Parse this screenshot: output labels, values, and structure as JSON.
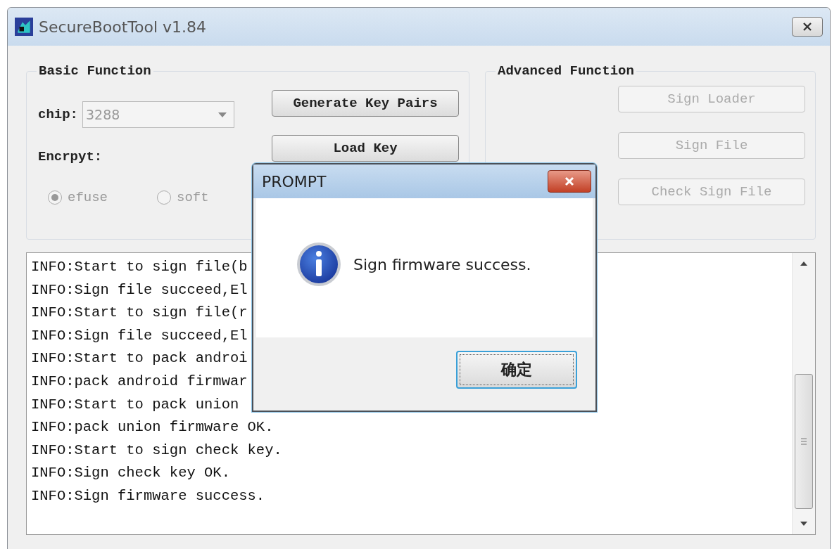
{
  "window": {
    "title": "SecureBootTool v1.84"
  },
  "basic_function": {
    "title": "Basic Function",
    "chip_label": "chip:",
    "chip": {
      "value": "3288",
      "disabled": true
    },
    "encrypt_label": "Encrpyt:",
    "encrypt_options": [
      {
        "label": "efuse",
        "selected": true,
        "disabled": true
      },
      {
        "label": "soft",
        "selected": false,
        "disabled": true
      }
    ],
    "buttons": [
      {
        "label": "Generate Key Pairs",
        "disabled": false
      },
      {
        "label": "Load Key",
        "disabled": false
      }
    ]
  },
  "advanced_function": {
    "title": "Advanced Function",
    "buttons": [
      {
        "label": "Sign Loader",
        "disabled": true
      },
      {
        "label": "Sign File",
        "disabled": true
      },
      {
        "label": "Check Sign File",
        "disabled": true
      }
    ]
  },
  "log": [
    "INFO:Start to sign file(b",
    "INFO:Sign file succeed,El",
    "INFO:Start to sign file(r",
    "INFO:Sign file succeed,El",
    "INFO:Start to pack androi",
    "INFO:pack android firmwar",
    "INFO:Start to pack union",
    "INFO:pack union firmware OK.",
    "INFO:Start to sign check key.",
    "INFO:Sign check key OK.",
    "INFO:Sign firmware success."
  ],
  "dialog": {
    "title": "PROMPT",
    "message": "Sign firmware success.",
    "ok_button": "确定"
  }
}
